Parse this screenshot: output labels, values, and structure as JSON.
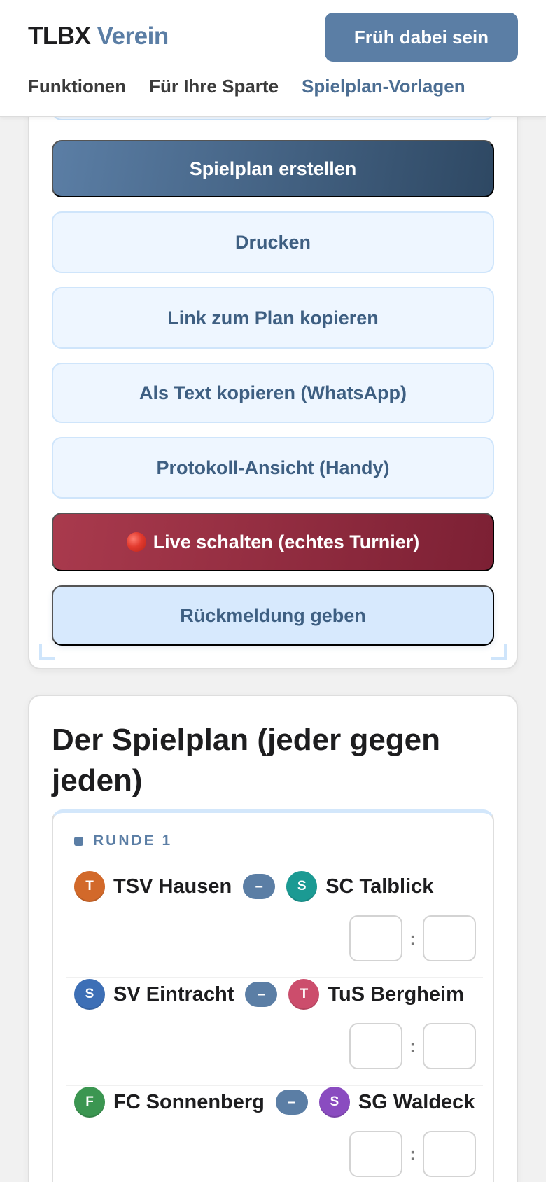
{
  "header": {
    "brand_main": "TLBX",
    "brand_accent": "Verein",
    "cta_label": "Früh dabei sein",
    "nav": [
      {
        "label": "Funktionen"
      },
      {
        "label": "Für Ihre Sparte"
      },
      {
        "label": "Spielplan-Vorlagen"
      }
    ]
  },
  "actions": {
    "create": "Spielplan erstellen",
    "print": "Drucken",
    "copy_link": "Link zum Plan kopieren",
    "copy_text": "Als Text kopieren (WhatsApp)",
    "protocol": "Protokoll-Ansicht (Handy)",
    "live": "Live schalten (echtes Turnier)",
    "feedback": "Rückmeldung geben"
  },
  "plan": {
    "title": "Der Spielplan (jeder gegen jeden)",
    "round_label": "RUNDE 1",
    "vs_symbol": "–",
    "score_separator": ":",
    "matches": [
      {
        "home": {
          "initial": "T",
          "name": "TSV Hausen",
          "color": "#d2692a"
        },
        "away": {
          "initial": "S",
          "name": "SC Talblick",
          "color": "#1b9a93"
        }
      },
      {
        "home": {
          "initial": "S",
          "name": "SV Eintracht",
          "color": "#3d6fb6"
        },
        "away": {
          "initial": "T",
          "name": "TuS Bergheim",
          "color": "#cc4d6c"
        }
      },
      {
        "home": {
          "initial": "F",
          "name": "FC Sonnenberg",
          "color": "#3b9651"
        },
        "away": {
          "initial": "S",
          "name": "SG Waldeck",
          "color": "#8a4cc0"
        }
      }
    ]
  },
  "colors": {
    "brand_accent": "#5b7ea5",
    "primary_dark": "#2e4863",
    "live_red": "#a93a4d",
    "light_blue_bg": "#eef6ff"
  }
}
